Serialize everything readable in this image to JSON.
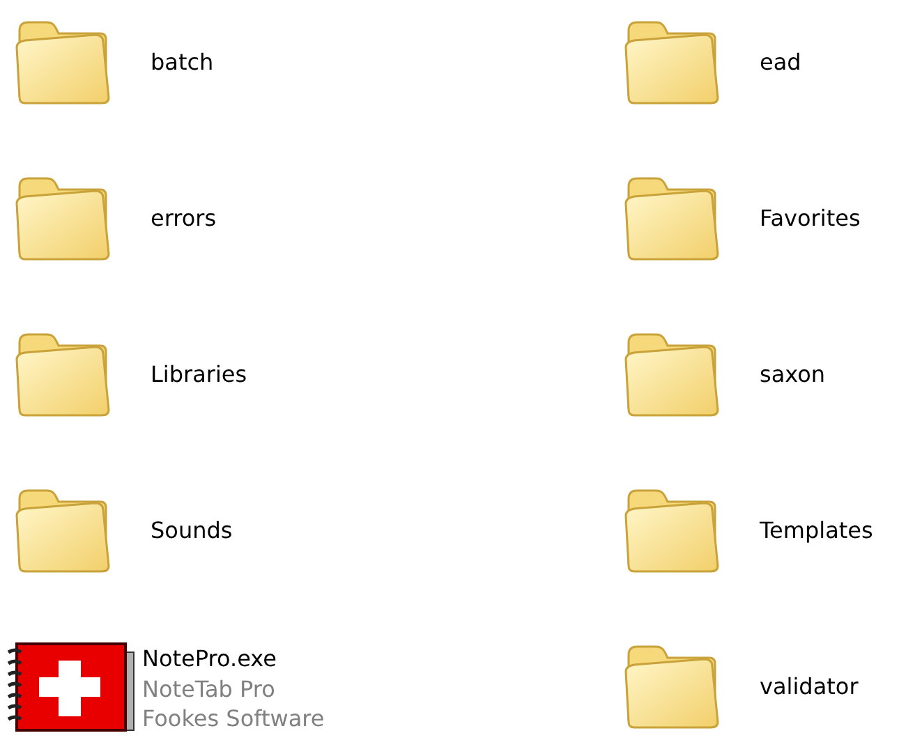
{
  "items": [
    {
      "kind": "folder",
      "name": "batch"
    },
    {
      "kind": "folder",
      "name": "ead"
    },
    {
      "kind": "folder",
      "name": "errors"
    },
    {
      "kind": "folder",
      "name": "Favorites"
    },
    {
      "kind": "folder",
      "name": "Libraries"
    },
    {
      "kind": "folder",
      "name": "saxon"
    },
    {
      "kind": "folder",
      "name": "Sounds"
    },
    {
      "kind": "folder",
      "name": "Templates"
    },
    {
      "kind": "application",
      "name": "NotePro.exe",
      "details": [
        "NoteTab Pro",
        "Fookes Software"
      ]
    },
    {
      "kind": "folder",
      "name": "validator"
    }
  ]
}
